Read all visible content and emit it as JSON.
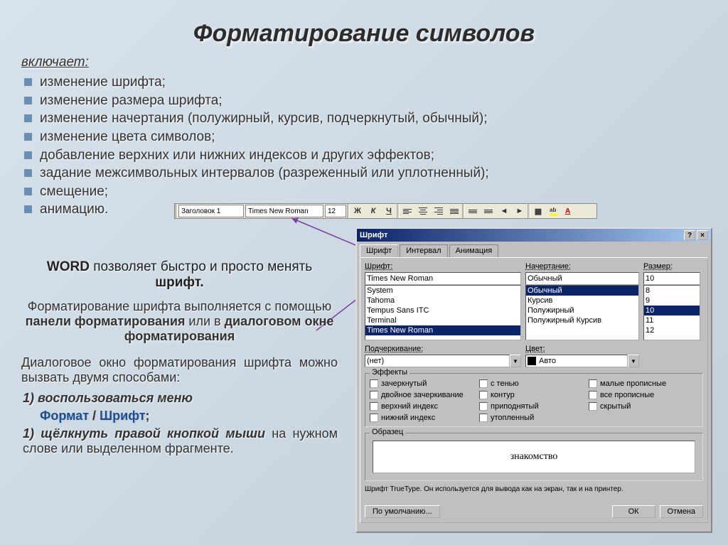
{
  "title": "Форматирование символов",
  "subtitle": "включает:",
  "bullets": [
    "изменение шрифта;",
    "изменение размера шрифта;",
    "изменение начертания (полужирный, курсив, подчеркнутый, обычный);",
    "изменение цвета символов;",
    "добавление верхних или нижних индексов и других эффектов;",
    "задание межсимвольных интервалов (разреженный или уплотненный);",
    "смещение;",
    "анимацию."
  ],
  "toolbar": {
    "style": "Заголовок 1",
    "font": "Times New Roman",
    "size": "12",
    "bold": "Ж",
    "italic": "К",
    "underline": "Ч"
  },
  "body": {
    "p1_a": "WORD",
    "p1_b": " позволяет быстро и просто менять ",
    "p1_c": "шрифт.",
    "p2_a": "Форматирование шрифта выполняется с помощью ",
    "p2_b": "панели форматирования",
    "p2_c": "     или в ",
    "p2_d": "диалоговом окне форматирования",
    "p3": "Диалоговое окно форматирования шрифта можно вызвать двумя способами:",
    "o1_idx": "1)",
    "o1_txt": "  воспользоваться меню",
    "o1_path1": "Формат",
    "o1_sep": " / ",
    "o1_path2": "Шрифт",
    "o1_semi": ";",
    "o2_idx": "1)",
    "o2_txt": "  щёлкнуть правой кнопкой мыши",
    "o2_tail": " на нужном слове или выделенном фрагменте."
  },
  "dialog": {
    "title": "Шрифт",
    "tabs": [
      "Шрифт",
      "Интервал",
      "Анимация"
    ],
    "font_label": "Шрифт:",
    "font_value": "Times New Roman",
    "font_list": [
      "System",
      "Tahoma",
      "Tempus Sans ITC",
      "Terminal",
      "Times New Roman"
    ],
    "style_label": "Начертание:",
    "style_value": "Обычный",
    "style_list": [
      "Обычный",
      "Курсив",
      "Полужирный",
      "Полужирный Курсив"
    ],
    "size_label": "Размер:",
    "size_value": "10",
    "size_list": [
      "8",
      "9",
      "10",
      "11",
      "12"
    ],
    "underline_label": "Подчеркивание:",
    "underline_value": "(нет)",
    "color_label": "Цвет:",
    "color_value": "Авто",
    "effects_legend": "Эффекты",
    "effects": {
      "col1": [
        "зачеркнутый",
        "двойное зачеркивание",
        "верхний индекс",
        "нижний индекс"
      ],
      "col2": [
        "с тенью",
        "контур",
        "приподнятый",
        "утопленный"
      ],
      "col3": [
        "малые прописные",
        "все прописные",
        "скрытый"
      ]
    },
    "sample_legend": "Образец",
    "sample_text": "знакомство",
    "hint": "Шрифт TrueType. Он используется для вывода как на экран, так и на принтер.",
    "btn_default": "По умолчанию...",
    "btn_ok": "ОК",
    "btn_cancel": "Отмена"
  }
}
